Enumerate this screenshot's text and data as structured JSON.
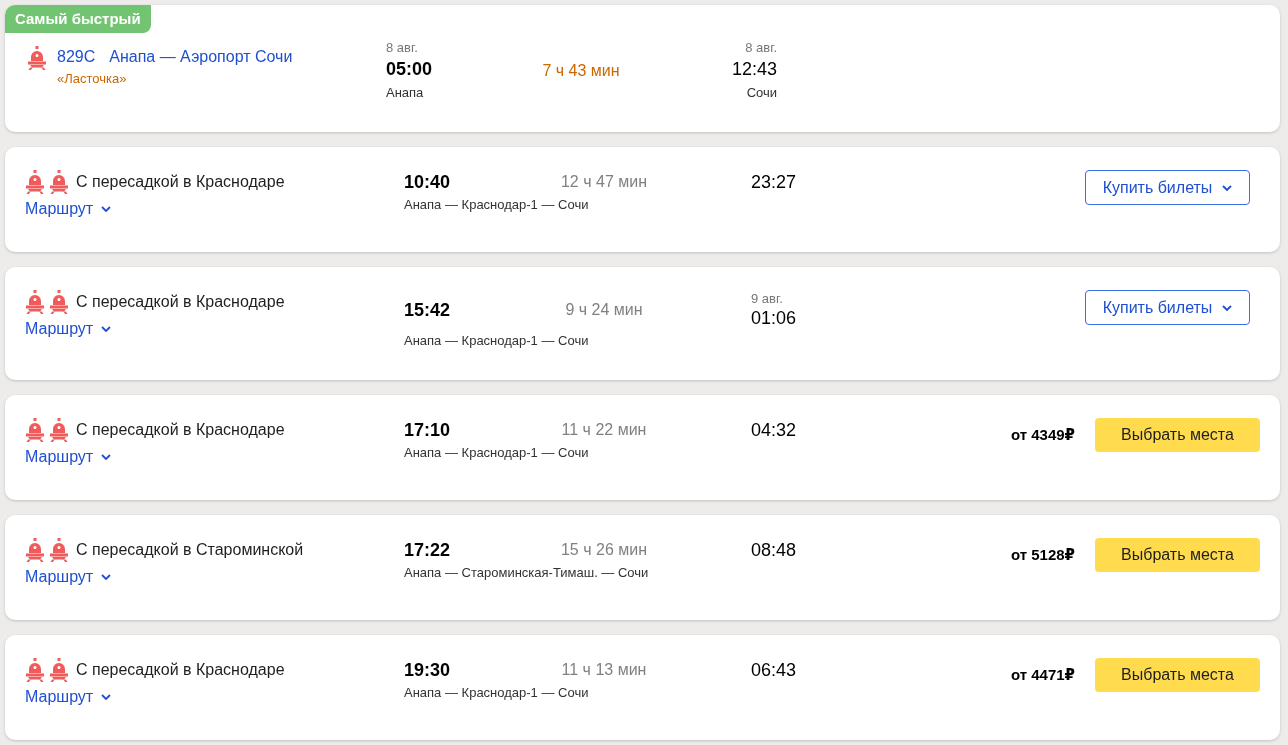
{
  "routes": [
    {
      "kind": "direct",
      "badge": "Самый быстрый",
      "train_number": "829С",
      "title": "Анапа — Аэропорт Сочи",
      "train_name": "«Ласточка»",
      "departure": {
        "date": "8 авг.",
        "time": "05:00",
        "station": "Анапа"
      },
      "duration": "7 ч 43 мин",
      "arrival": {
        "date": "8 авг.",
        "time": "12:43",
        "station": "Сочи"
      }
    },
    {
      "kind": "transfer",
      "title": "С пересадкой в Краснодаре",
      "route_link": "Маршрут",
      "departure": {
        "time": "10:40"
      },
      "duration": "12 ч 47 мин",
      "arrival": {
        "time": "23:27"
      },
      "stations": "Анапа — Краснодар-1 — Сочи",
      "action": {
        "kind": "dropdown",
        "label": "Купить билеты"
      }
    },
    {
      "kind": "transfer",
      "title": "С пересадкой в Краснодаре",
      "route_link": "Маршрут",
      "departure": {
        "time": "15:42"
      },
      "duration": "9 ч 24 мин",
      "arrival": {
        "date": "9 авг.",
        "time": "01:06"
      },
      "stations": "Анапа — Краснодар-1 — Сочи",
      "action": {
        "kind": "dropdown",
        "label": "Купить билеты"
      }
    },
    {
      "kind": "transfer",
      "title": "С пересадкой в Краснодаре",
      "route_link": "Маршрут",
      "departure": {
        "time": "17:10"
      },
      "duration": "11 ч 22 мин",
      "arrival": {
        "time": "04:32"
      },
      "stations": "Анапа — Краснодар-1 — Сочи",
      "price": "от 4349₽",
      "action": {
        "kind": "primary",
        "label": "Выбрать места"
      }
    },
    {
      "kind": "transfer",
      "title": "С пересадкой в Староминской",
      "route_link": "Маршрут",
      "departure": {
        "time": "17:22"
      },
      "duration": "15 ч 26 мин",
      "arrival": {
        "time": "08:48"
      },
      "stations": "Анапа — Староминская-Тимаш. — Сочи",
      "price": "от 5128₽",
      "action": {
        "kind": "primary",
        "label": "Выбрать места"
      }
    },
    {
      "kind": "transfer",
      "title": "С пересадкой в Краснодаре",
      "route_link": "Маршрут",
      "departure": {
        "time": "19:30"
      },
      "duration": "11 ч 13 мин",
      "arrival": {
        "time": "06:43"
      },
      "stations": "Анапа — Краснодар-1 — Сочи",
      "price": "от 4471₽",
      "action": {
        "kind": "primary",
        "label": "Выбрать места"
      }
    }
  ]
}
